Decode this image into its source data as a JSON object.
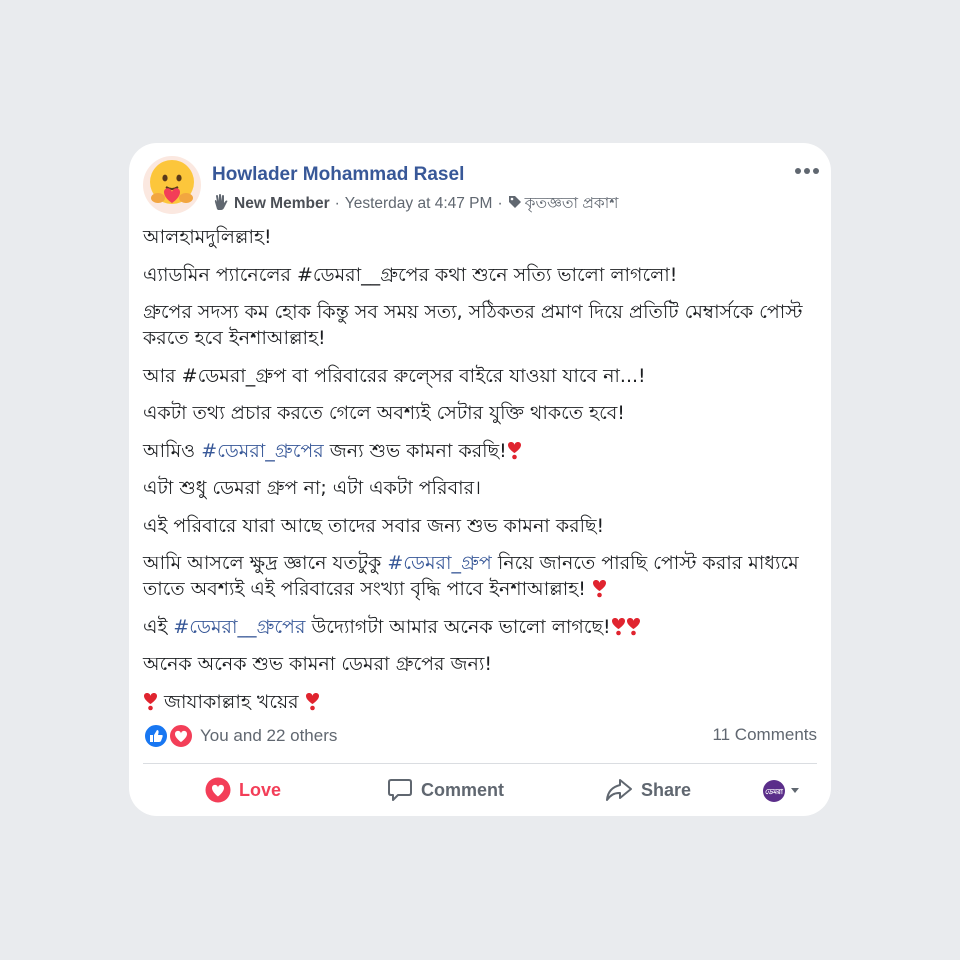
{
  "post": {
    "author": "Howlader Mohammad Rasel",
    "badge": "New Member",
    "separator": "·",
    "timestamp": "Yesterday at 4:47 PM",
    "tag": "কৃতজ্ঞতা প্রকাশ",
    "lines": [
      "আলহামদুলিল্লাহ!",
      "এ্যাডমিন প্যানেলের #ডেমরা__গ্রুপের কথা শুনে সত্যি ভালো লাগলো!",
      "গ্রুপের সদস্য কম হোক কিন্তু সব সময় সত্য, সঠিকতর প্রমাণ দিয়ে প্রতিটি মেম্বার্সকে পোস্ট করতে হবে ইনশাআল্লাহ!",
      "আর #ডেমরা_গ্রুপ বা পরিবারের রুল্সের বাইরে যাওয়া যাবে না...!",
      "একটা তথ্য প্রচার করতে গেলে অবশ্যই সেটার যুক্তি থাকতে হবে!",
      {
        "pre": "আমিও ",
        "hashtag": "#ডেমরা_গ্রুপের",
        "post": " জন্য শুভ কামনা করছি!"
      },
      "এটা শুধু ডেমরা গ্রুপ না; এটা একটা পরিবার।",
      "এই পরিবারে যারা আছে তাদের সবার জন্য শুভ কামনা করছি!",
      {
        "pre": "আমি আসলে ক্ষুদ্র জ্ঞানে যতটুকু ",
        "hashtag": "#ডেমরা_গ্রুপ",
        "post": " নিয়ে জানতে পারছি পোস্ট করার মাধ্যমে তাতে অবশ্যই এই পরিবারের সংখ্যা বৃদ্ধি পাবে ইনশাআল্লাহ! "
      },
      {
        "pre": "এই ",
        "hashtag": "#ডেমরা__গ্রুপের",
        "post": " উদ্যোগটা আমার অনেক ভালো লাগছে!"
      },
      "অনেক অনেক শুভ কামনা ডেমরা গ্রুপের জন্য!",
      " জাযাকাল্লাহ খয়ের "
    ]
  },
  "reactions": {
    "summary": "You and 22 others",
    "comments": "11 Comments"
  },
  "actions": {
    "love": "Love",
    "comment": "Comment",
    "share": "Share"
  },
  "viewer_avatar_text": "ডেমরা",
  "colors": {
    "background": "#e9ebee",
    "link": "#385898",
    "love": "#f33e58",
    "like": "#1877f2",
    "text": "#1c1e21",
    "meta": "#606770"
  }
}
